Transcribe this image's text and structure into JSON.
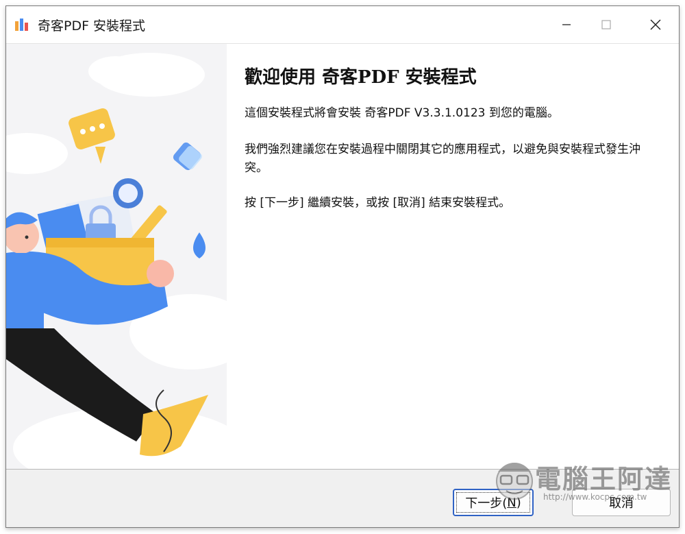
{
  "window": {
    "title": "奇客PDF 安裝程式"
  },
  "content": {
    "heading": "歡迎使用 奇客PDF 安裝程式",
    "paragraphs": [
      "這個安裝程式將會安裝 奇客PDF V3.3.1.0123 到您的電腦。",
      "我們強烈建議您在安裝過程中關閉其它的應用程式，以避免與安裝程式發生沖突。",
      "按 [下一步] 繼續安裝，或按 [取消] 結束安裝程式。"
    ]
  },
  "buttons": {
    "next_label": "下一步(",
    "next_mnemonic": "N",
    "next_suffix": ")",
    "cancel_label": "取消"
  },
  "watermark": {
    "text": "電腦王阿達",
    "url": "http://www.kocpc.com.tw"
  },
  "icons": {
    "app": "qike-pdf-app-icon",
    "minimize": "minimize-icon",
    "maximize": "maximize-icon",
    "close": "close-icon"
  },
  "colors": {
    "accent": "#2f62c5",
    "illustration_blue": "#4a8cf0",
    "illustration_yellow": "#f7c548"
  }
}
